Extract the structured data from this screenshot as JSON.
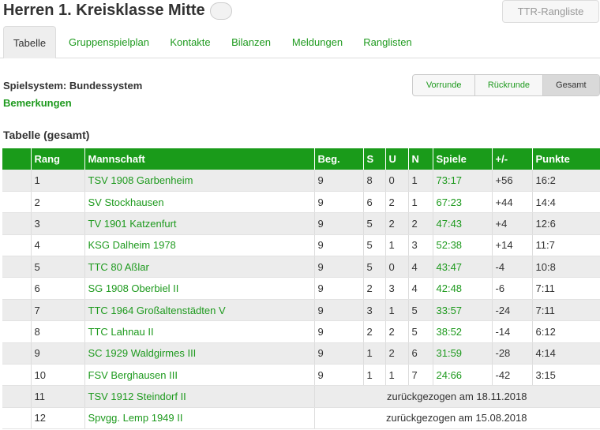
{
  "header": {
    "title": "Herren 1. Kreisklasse Mitte",
    "ttr_button": "TTR-Rangliste"
  },
  "tabs": [
    {
      "label": "Tabelle",
      "active": true
    },
    {
      "label": "Gruppenspielplan",
      "active": false
    },
    {
      "label": "Kontakte",
      "active": false
    },
    {
      "label": "Bilanzen",
      "active": false
    },
    {
      "label": "Meldungen",
      "active": false
    },
    {
      "label": "Ranglisten",
      "active": false
    }
  ],
  "info": {
    "spielsystem": "Spielsystem: Bundessystem",
    "bemerkungen": "Bemerkungen"
  },
  "segments": {
    "vorrunde": "Vorrunde",
    "rueckrunde": "Rückrunde",
    "gesamt": "Gesamt",
    "selected": "Gesamt"
  },
  "table": {
    "title": "Tabelle (gesamt)",
    "headers": {
      "rang": "Rang",
      "mannschaft": "Mannschaft",
      "beg": "Beg.",
      "s": "S",
      "u": "U",
      "n": "N",
      "spiele": "Spiele",
      "diff": "+/-",
      "punkte": "Punkte"
    },
    "rows": [
      {
        "rang": "1",
        "team": "TSV 1908 Garbenheim",
        "beg": "9",
        "s": "8",
        "u": "0",
        "n": "1",
        "spiele": "73:17",
        "diff": "+56",
        "punkte": "16:2"
      },
      {
        "rang": "2",
        "team": "SV Stockhausen",
        "beg": "9",
        "s": "6",
        "u": "2",
        "n": "1",
        "spiele": "67:23",
        "diff": "+44",
        "punkte": "14:4"
      },
      {
        "rang": "3",
        "team": "TV 1901 Katzenfurt",
        "beg": "9",
        "s": "5",
        "u": "2",
        "n": "2",
        "spiele": "47:43",
        "diff": "+4",
        "punkte": "12:6"
      },
      {
        "rang": "4",
        "team": "KSG Dalheim 1978",
        "beg": "9",
        "s": "5",
        "u": "1",
        "n": "3",
        "spiele": "52:38",
        "diff": "+14",
        "punkte": "11:7"
      },
      {
        "rang": "5",
        "team": "TTC 80 Aßlar",
        "beg": "9",
        "s": "5",
        "u": "0",
        "n": "4",
        "spiele": "43:47",
        "diff": "-4",
        "punkte": "10:8"
      },
      {
        "rang": "6",
        "team": "SG 1908 Oberbiel II",
        "beg": "9",
        "s": "2",
        "u": "3",
        "n": "4",
        "spiele": "42:48",
        "diff": "-6",
        "punkte": "7:11"
      },
      {
        "rang": "7",
        "team": "TTC 1964 Großaltenstädten V",
        "beg": "9",
        "s": "3",
        "u": "1",
        "n": "5",
        "spiele": "33:57",
        "diff": "-24",
        "punkte": "7:11"
      },
      {
        "rang": "8",
        "team": "TTC Lahnau II",
        "beg": "9",
        "s": "2",
        "u": "2",
        "n": "5",
        "spiele": "38:52",
        "diff": "-14",
        "punkte": "6:12"
      },
      {
        "rang": "9",
        "team": "SC 1929 Waldgirmes III",
        "beg": "9",
        "s": "1",
        "u": "2",
        "n": "6",
        "spiele": "31:59",
        "diff": "-28",
        "punkte": "4:14"
      },
      {
        "rang": "10",
        "team": "FSV Berghausen III",
        "beg": "9",
        "s": "1",
        "u": "1",
        "n": "7",
        "spiele": "24:66",
        "diff": "-42",
        "punkte": "3:15"
      }
    ],
    "withdrawn": [
      {
        "rang": "11",
        "team": "TSV 1912 Steindorf II",
        "note": "zurückgezogen am 18.11.2018"
      },
      {
        "rang": "12",
        "team": "Spvgg. Lemp 1949 II",
        "note": "zurückgezogen am 15.08.2018"
      }
    ]
  },
  "colors": {
    "accent": "#1a9b1a",
    "link": "#1e9a1e"
  }
}
